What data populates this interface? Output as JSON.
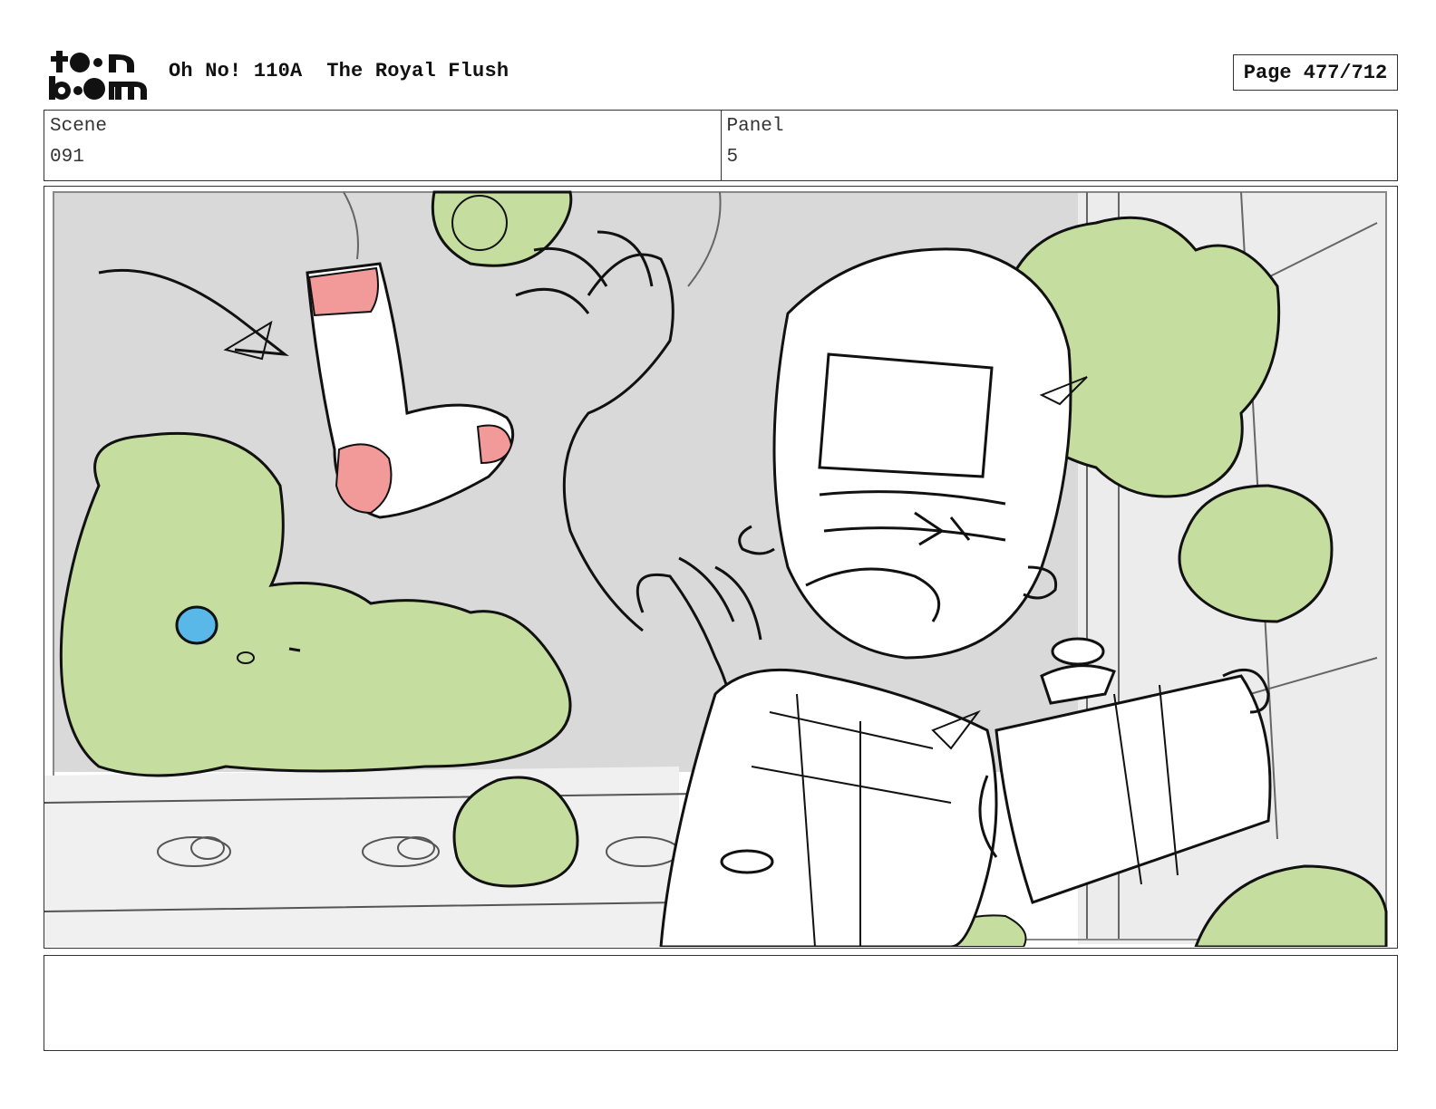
{
  "header": {
    "logo_text": "toon boom",
    "title": "Oh No! 110A  The Royal Flush",
    "page": "Page 477/712"
  },
  "scene": {
    "label": "Scene",
    "value": "091"
  },
  "panel": {
    "label": "Panel",
    "value": "5"
  },
  "notes": {
    "text": ""
  },
  "colors": {
    "slime_green": "#c5dea0",
    "sock_red": "#f2999a",
    "eye_blue": "#5ab8e8",
    "background_grey": "#d8d8d8",
    "ink": "#111111"
  }
}
